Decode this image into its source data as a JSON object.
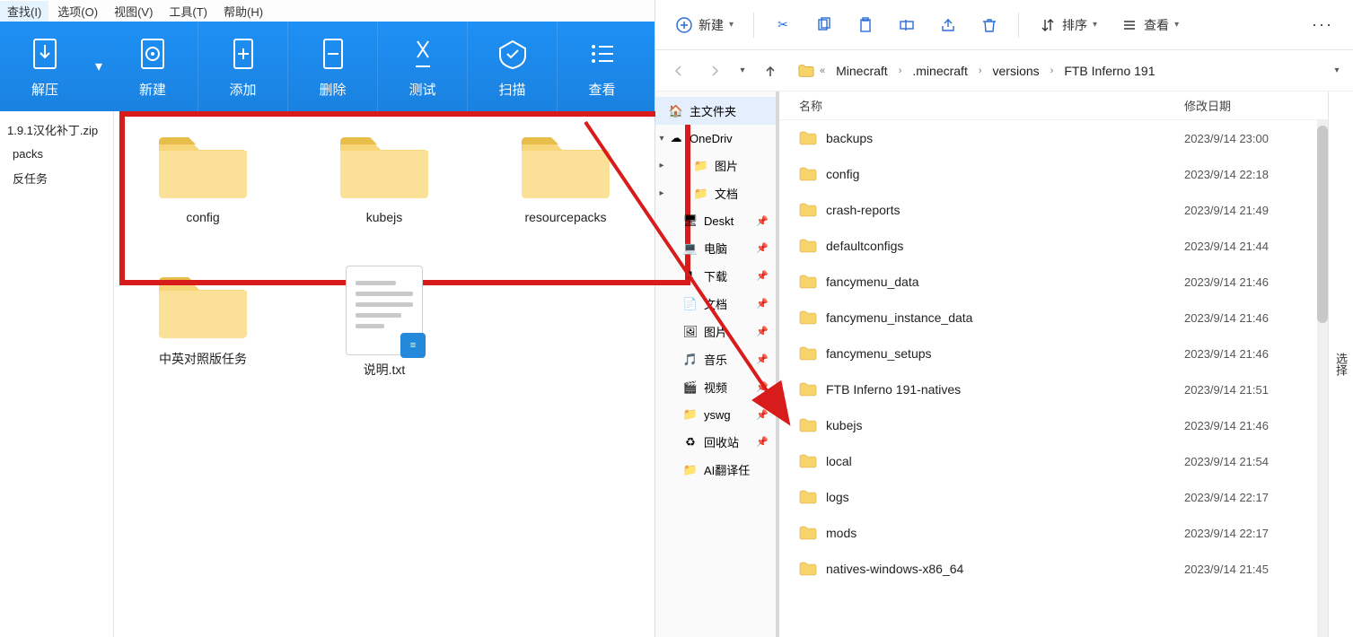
{
  "left": {
    "menu": [
      "查找(I)",
      "选项(O)",
      "视图(V)",
      "工具(T)",
      "帮助(H)"
    ],
    "toolbar": [
      {
        "id": "extract",
        "label": "解压"
      },
      {
        "id": "new",
        "label": "新建"
      },
      {
        "id": "add",
        "label": "添加"
      },
      {
        "id": "delete",
        "label": "删除"
      },
      {
        "id": "test",
        "label": "测试"
      },
      {
        "id": "scan",
        "label": "扫描"
      },
      {
        "id": "view",
        "label": "查看"
      }
    ],
    "sidebar": [
      "1.9.1汉化补丁.zip",
      "packs",
      "反任务"
    ],
    "grid_row1": [
      {
        "id": "config",
        "label": "config",
        "type": "folder"
      },
      {
        "id": "kubejs",
        "label": "kubejs",
        "type": "folder"
      },
      {
        "id": "resourcepacks",
        "label": "resourcepacks",
        "type": "folder"
      }
    ],
    "grid_row2": [
      {
        "id": "cn-en",
        "label": "中英对照版任务",
        "type": "folder"
      },
      {
        "id": "readme",
        "label": "说明.txt",
        "type": "txt"
      }
    ]
  },
  "right": {
    "cmd": {
      "new_label": "新建",
      "sort_label": "排序",
      "view_label": "查看"
    },
    "breadcrumb": [
      "Minecraft",
      ".minecraft",
      "versions",
      "FTB Inferno 191"
    ],
    "columns": {
      "name": "名称",
      "date": "修改日期"
    },
    "tree": [
      {
        "label": "主文件夹",
        "icon": "home",
        "selected": true
      },
      {
        "label": "OneDriv",
        "icon": "onedrive",
        "twisty": "▾"
      },
      {
        "label": "图片",
        "icon": "folder",
        "indent": 2,
        "twisty": "▸"
      },
      {
        "label": "文档",
        "icon": "folder",
        "indent": 2,
        "twisty": "▸"
      },
      {
        "label": "Deskt",
        "icon": "desktop",
        "indent": 1,
        "pin": true
      },
      {
        "label": "电脑",
        "icon": "pc",
        "indent": 1,
        "pin": true
      },
      {
        "label": "下载",
        "icon": "download",
        "indent": 1,
        "pin": true
      },
      {
        "label": "文档",
        "icon": "doc",
        "indent": 1,
        "pin": true
      },
      {
        "label": "图片",
        "icon": "image",
        "indent": 1,
        "pin": true
      },
      {
        "label": "音乐",
        "icon": "music",
        "indent": 1,
        "pin": true
      },
      {
        "label": "视频",
        "icon": "video",
        "indent": 1,
        "pin": true
      },
      {
        "label": "yswg",
        "icon": "folder",
        "indent": 1,
        "pin": true
      },
      {
        "label": "回收站",
        "icon": "recycle",
        "indent": 1,
        "pin": true
      },
      {
        "label": "AI翻译任",
        "icon": "folder",
        "indent": 1
      }
    ],
    "files": [
      {
        "name": "backups",
        "date": "2023/9/14 23:00"
      },
      {
        "name": "config",
        "date": "2023/9/14 22:18"
      },
      {
        "name": "crash-reports",
        "date": "2023/9/14 21:49"
      },
      {
        "name": "defaultconfigs",
        "date": "2023/9/14 21:44"
      },
      {
        "name": "fancymenu_data",
        "date": "2023/9/14 21:46"
      },
      {
        "name": "fancymenu_instance_data",
        "date": "2023/9/14 21:46"
      },
      {
        "name": "fancymenu_setups",
        "date": "2023/9/14 21:46"
      },
      {
        "name": "FTB Inferno 191-natives",
        "date": "2023/9/14 21:51"
      },
      {
        "name": "kubejs",
        "date": "2023/9/14 21:46"
      },
      {
        "name": "local",
        "date": "2023/9/14 21:54"
      },
      {
        "name": "logs",
        "date": "2023/9/14 22:17"
      },
      {
        "name": "mods",
        "date": "2023/9/14 22:17"
      },
      {
        "name": "natives-windows-x86_64",
        "date": "2023/9/14 21:45"
      }
    ],
    "right_edge": "选择"
  }
}
